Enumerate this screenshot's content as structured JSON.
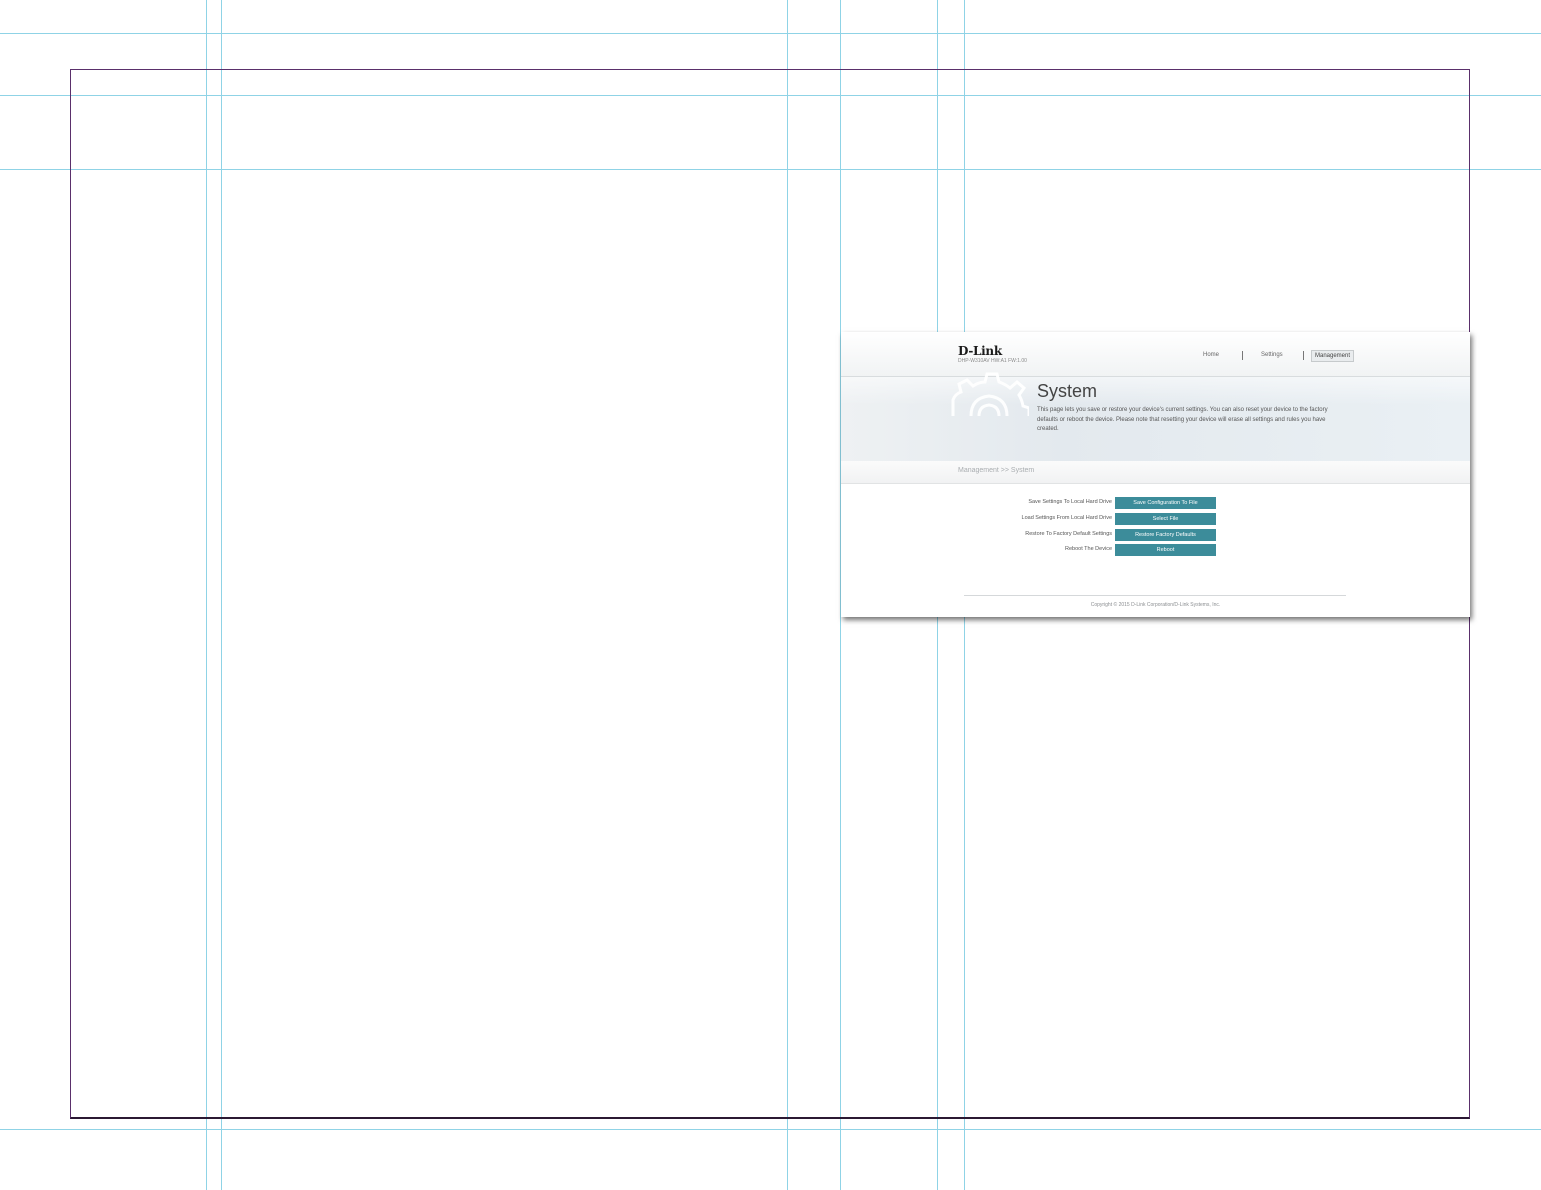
{
  "device_ui": {
    "logo": "D-Link",
    "model_line": "DHP-W310AV  HW:A1  FW:1.00",
    "nav": {
      "home": "Home",
      "settings": "Settings",
      "management": "Management"
    },
    "page": {
      "title": "System",
      "description": "This page lets you save or restore your device's current settings. You can also reset your device to the factory defaults or reboot the device. Please note that resetting your device will erase all settings and rules you have created.",
      "breadcrumb": "Management >> System"
    },
    "actions": [
      {
        "label": "Save Settings To Local Hard Drive",
        "button": "Save Configuration To File"
      },
      {
        "label": "Load Settings From Local Hard Drive",
        "button": "Select File"
      },
      {
        "label": "Restore To Factory Default Settings",
        "button": "Restore Factory Defaults"
      },
      {
        "label": "Reboot The Device",
        "button": "Reboot"
      }
    ],
    "copyright": "Copyright © 2015 D-Link Corporation/D-Link Systems, Inc."
  },
  "colors": {
    "button_bg": "#3c8c9a",
    "guide_line": "#8fd3e6",
    "page_frame": "#5a2f6b"
  }
}
